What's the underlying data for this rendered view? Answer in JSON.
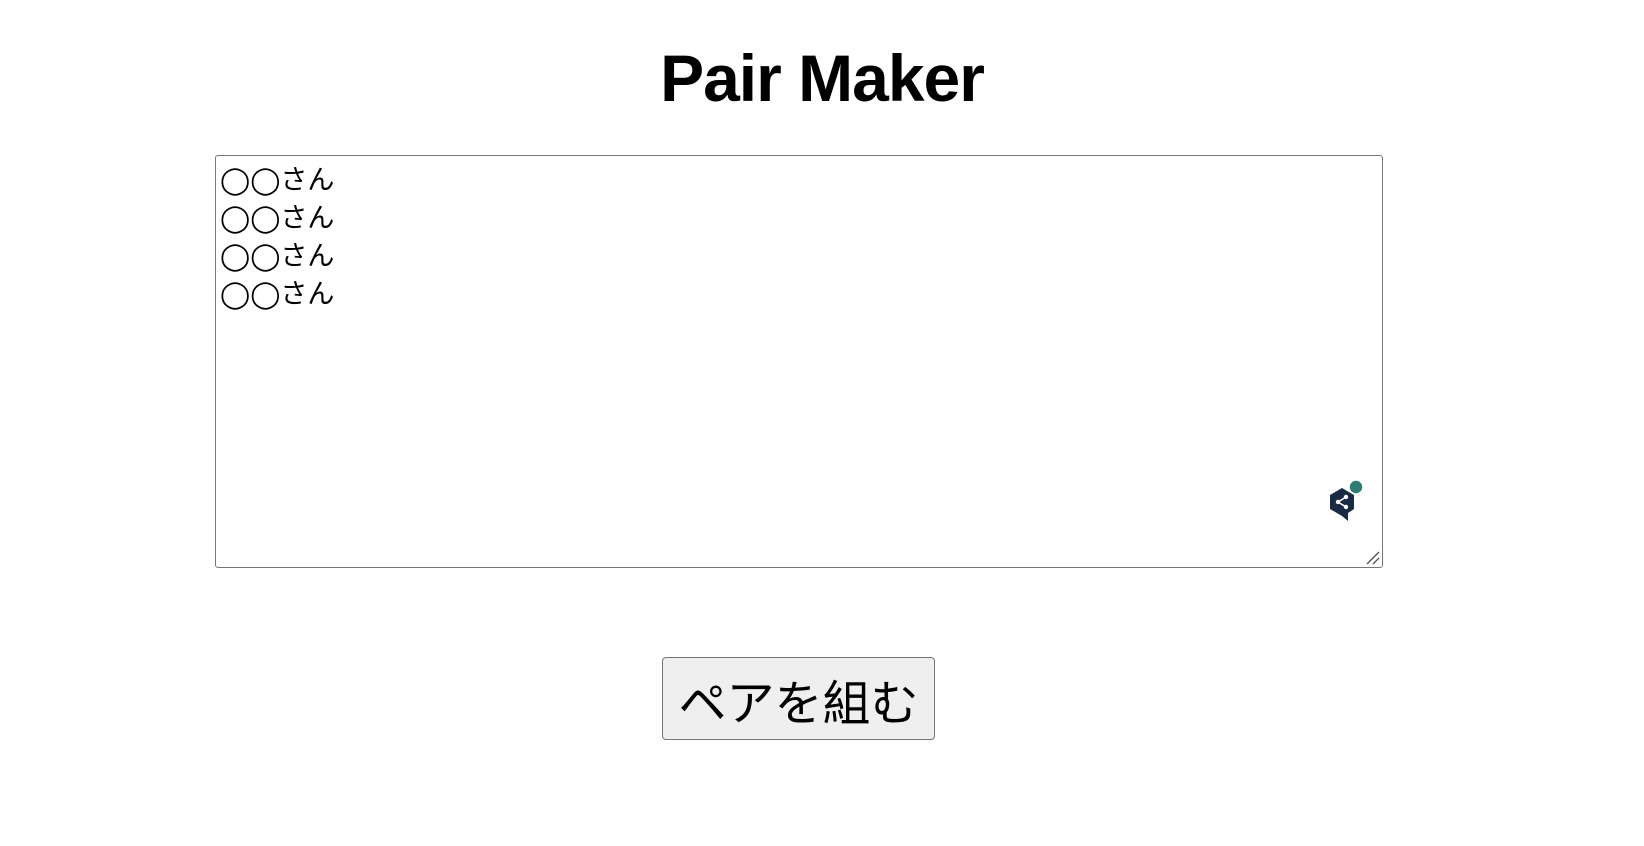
{
  "page": {
    "title": "Pair Maker"
  },
  "names_input": {
    "value": "◯◯さん\n◯◯さん\n◯◯さん\n◯◯さん"
  },
  "extension_badge": {
    "icon": "translator-extension-icon",
    "brand_color": "#1b2a44",
    "status_color": "#2e7d74"
  },
  "actions": {
    "make_pairs_label": "ペアを組む"
  }
}
